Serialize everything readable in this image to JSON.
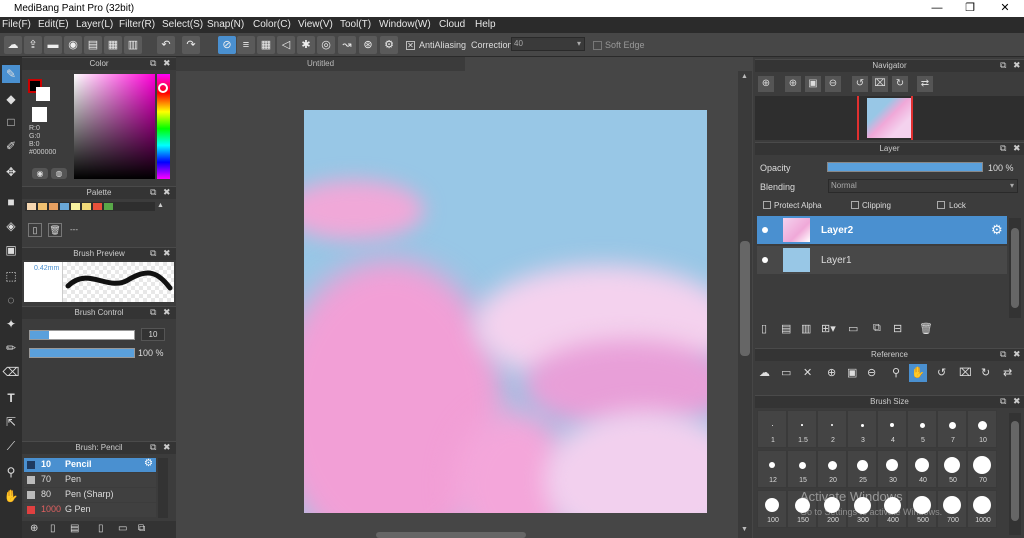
{
  "app": {
    "title": "MediBang Paint Pro (32bit)"
  },
  "window_buttons": {
    "minimize": "—",
    "maximize": "❐",
    "close": "✕"
  },
  "menu": [
    "File(F)",
    "Edit(E)",
    "Layer(L)",
    "Filter(R)",
    "Select(S)",
    "Snap(N)",
    "Color(C)",
    "View(V)",
    "Tool(T)",
    "Window(W)",
    "Cloud",
    "Help"
  ],
  "toolbar": {
    "antialiasing_label": "AntiAliasing",
    "correction_label": "Correction",
    "correction_value": "40",
    "soft_edge_label": "Soft Edge"
  },
  "color_panel": {
    "title": "Color",
    "r": "R:0",
    "g": "G:0",
    "b": "B:0",
    "hex": "#000000"
  },
  "palette_panel": {
    "title": "Palette",
    "empty": "---",
    "swatches": [
      "#f5d6b0",
      "#f0c070",
      "#e8a060",
      "#6aa8d8",
      "#f7f2a0",
      "#f0d878",
      "#e8503a",
      "#58a848"
    ]
  },
  "brush_preview": {
    "title": "Brush Preview",
    "size": "0.42mm"
  },
  "brush_control": {
    "title": "Brush Control",
    "size_value": "10",
    "opacity_value": "100 %"
  },
  "brush_list": {
    "title": "Brush: Pencil",
    "items": [
      {
        "size": "10",
        "name": "Pencil",
        "color": "#1e3a60"
      },
      {
        "size": "70",
        "name": "Pen",
        "color": "#bbbbbb"
      },
      {
        "size": "80",
        "name": "Pen (Sharp)",
        "color": "#bbbbbb"
      },
      {
        "size": "1000",
        "name": "G Pen",
        "color": "#e04040"
      }
    ]
  },
  "document": {
    "tab": "Untitled"
  },
  "navigator": {
    "title": "Navigator"
  },
  "layer_panel": {
    "title": "Layer",
    "opacity_label": "Opacity",
    "opacity_value": "100 %",
    "blending_label": "Blending",
    "blending_value": "Normal",
    "protect_alpha": "Protect Alpha",
    "clipping": "Clipping",
    "lock": "Lock",
    "layers": [
      {
        "name": "Layer2"
      },
      {
        "name": "Layer1"
      }
    ]
  },
  "reference": {
    "title": "Reference"
  },
  "brush_size": {
    "title": "Brush Size",
    "rows": [
      [
        "1",
        "1.5",
        "2",
        "3",
        "4",
        "5",
        "7",
        "10"
      ],
      [
        "12",
        "15",
        "20",
        "25",
        "30",
        "40",
        "50",
        "70"
      ],
      [
        "100",
        "150",
        "200",
        "300",
        "400",
        "500",
        "700",
        "1000"
      ]
    ]
  },
  "watermark": {
    "line1": "Activate Windows",
    "line2": "Go to Settings to activate Windows."
  }
}
